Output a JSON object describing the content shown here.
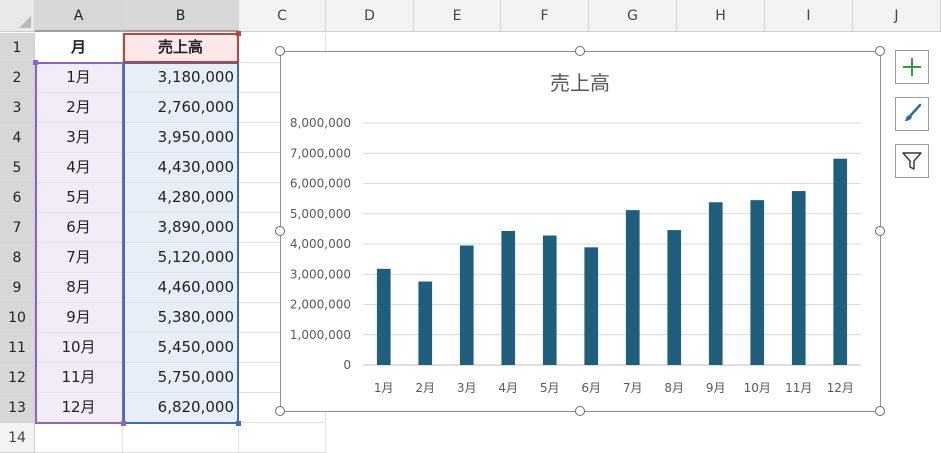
{
  "columns": [
    "A",
    "B",
    "C",
    "D",
    "E",
    "F",
    "G",
    "H",
    "I",
    "J"
  ],
  "rows": [
    "1",
    "2",
    "3",
    "4",
    "5",
    "6",
    "7",
    "8",
    "9",
    "10",
    "11",
    "12",
    "13",
    "14"
  ],
  "table": {
    "header_month": "月",
    "header_sales": "売上高",
    "months": [
      "1月",
      "2月",
      "3月",
      "4月",
      "5月",
      "6月",
      "7月",
      "8月",
      "9月",
      "10月",
      "11月",
      "12月"
    ],
    "sales": [
      "3,180,000",
      "2,760,000",
      "3,950,000",
      "4,430,000",
      "4,280,000",
      "3,890,000",
      "5,120,000",
      "4,460,000",
      "5,380,000",
      "5,450,000",
      "5,750,000",
      "6,820,000"
    ]
  },
  "colors": {
    "bar": "#1f5f7d",
    "month_ref": "#8a63c6",
    "sales_ref": "#3b6fb3",
    "header_ref": "#c0423f",
    "gridline": "#d9d9d9"
  },
  "side_buttons": {
    "add_icon": "plus-icon",
    "style_icon": "brush-icon",
    "filter_icon": "funnel-icon"
  },
  "chart_data": {
    "type": "bar",
    "title": "売上高",
    "categories": [
      "1月",
      "2月",
      "3月",
      "4月",
      "5月",
      "6月",
      "7月",
      "8月",
      "9月",
      "10月",
      "11月",
      "12月"
    ],
    "values": [
      3180000,
      2760000,
      3950000,
      4430000,
      4280000,
      3890000,
      5120000,
      4460000,
      5380000,
      5450000,
      5750000,
      6820000
    ],
    "ylim": [
      0,
      8000000
    ],
    "y_ticks": [
      0,
      1000000,
      2000000,
      3000000,
      4000000,
      5000000,
      6000000,
      7000000,
      8000000
    ],
    "y_tick_labels": [
      "0",
      "1,000,000",
      "2,000,000",
      "3,000,000",
      "4,000,000",
      "5,000,000",
      "6,000,000",
      "7,000,000",
      "8,000,000"
    ],
    "grid": true,
    "legend": "none"
  }
}
